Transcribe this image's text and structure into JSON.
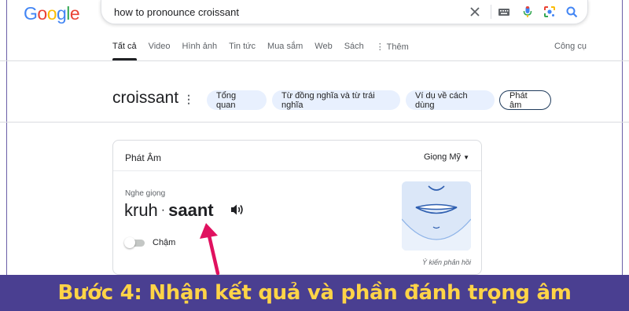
{
  "logo": {
    "letters": [
      "G",
      "o",
      "o",
      "g",
      "l",
      "e"
    ]
  },
  "search": {
    "query": "how to pronounce croissant"
  },
  "tabs": [
    {
      "label": "Tất cả",
      "active": true
    },
    {
      "label": "Video"
    },
    {
      "label": "Hình ảnh"
    },
    {
      "label": "Tin tức"
    },
    {
      "label": "Mua sắm"
    },
    {
      "label": "Web"
    },
    {
      "label": "Sách"
    },
    {
      "label": "⋮ Thêm"
    }
  ],
  "tools_label": "Công cụ",
  "word": "croissant",
  "chips": [
    "Tổng quan",
    "Từ đồng nghĩa và từ trái nghĩa",
    "Ví dụ về cách dùng",
    "Phát âm"
  ],
  "card": {
    "title": "Phát Âm",
    "accent": "Giọng Mỹ",
    "listen_label": "Nghe giọng",
    "syllable_1": "kruh",
    "separator": "·",
    "syllable_2": "saant",
    "slow_label": "Chậm",
    "slow_on": false,
    "feedback": "Ý kiến phản hồi"
  },
  "banner": {
    "text": "Bước 4: Nhận kết quả và phần đánh trọng âm",
    "bg": "#4a3f91",
    "color": "#ffd447"
  },
  "colors": {
    "accent_blue": "#1a73e8",
    "chip_bg": "#e8f0fe",
    "annotation_arrow": "#e0115f"
  }
}
